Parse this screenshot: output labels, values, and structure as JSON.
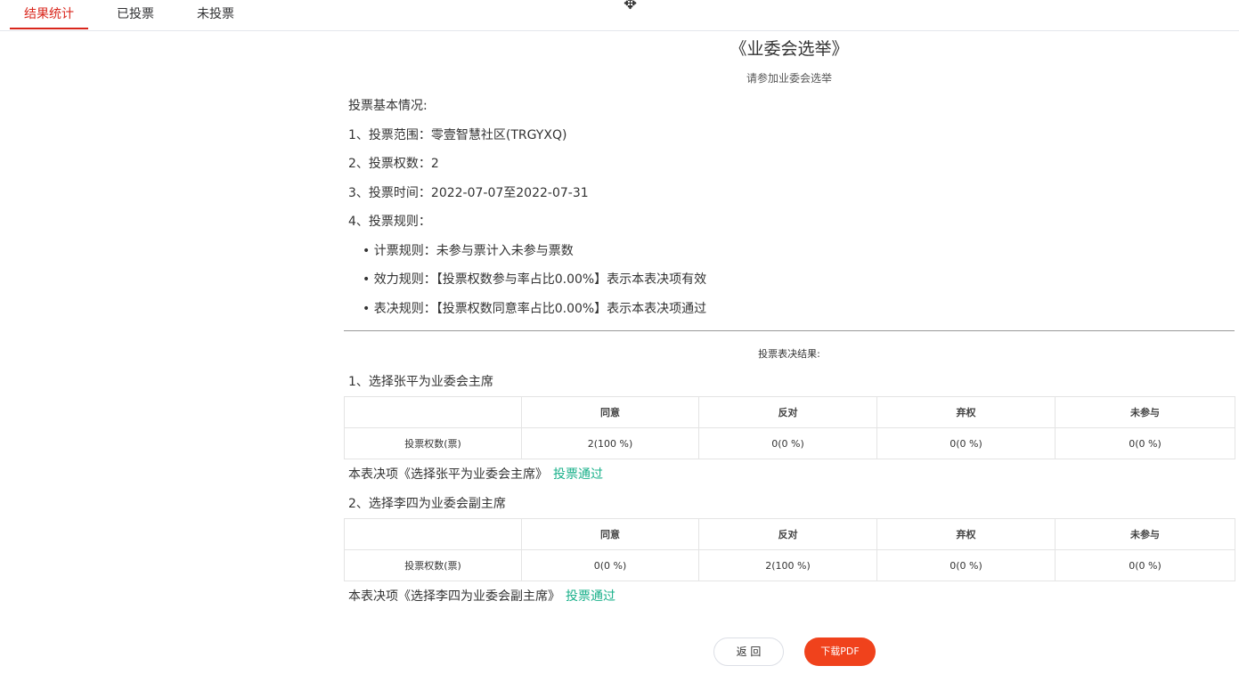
{
  "tabs": [
    {
      "label": "结果统计",
      "active": true
    },
    {
      "label": "已投票",
      "active": false
    },
    {
      "label": "未投票",
      "active": false
    }
  ],
  "title": "《业委会选举》",
  "subtitle": "请参加业委会选举",
  "basic_info": {
    "heading": "投票基本情况:",
    "scope": "1、投票范围：零壹智慧社区(TRGYXQ)",
    "weight": "2、投票权数：2",
    "time": "3、投票时间：2022-07-07至2022-07-31",
    "rules_heading": "4、投票规则："
  },
  "rules": [
    "• 计票规则：未参与票计入未参与票数",
    "• 效力规则：【投票权数参与率占比0.00%】表示本表决项有效",
    "• 表决规则：【投票权数同意率占比0.00%】表示本表决项通过"
  ],
  "results_heading": "投票表决结果:",
  "table_columns": [
    "",
    "同意",
    "反对",
    "弃权",
    "未参与"
  ],
  "items": [
    {
      "title": "1、选择张平为业委会主席",
      "row_label": "投票权数(票)",
      "values": [
        "2(100 %)",
        "0(0 %)",
        "0(0 %)",
        "0(0 %)"
      ],
      "verdict_text": "本表决项《选择张平为业委会主席》",
      "verdict_status": "投票通过"
    },
    {
      "title": "2、选择李四为业委会副主席",
      "row_label": "投票权数(票)",
      "values": [
        "0(0 %)",
        "2(100 %)",
        "0(0 %)",
        "0(0 %)"
      ],
      "verdict_text": "本表决项《选择李四为业委会副主席》",
      "verdict_status": "投票通过"
    }
  ],
  "buttons": {
    "back": "返 回",
    "download_pdf": "下载PDF"
  },
  "colors": {
    "active_tab": "#d9261c",
    "pass": "#19b08a",
    "pdf_button": "#f0421c"
  }
}
